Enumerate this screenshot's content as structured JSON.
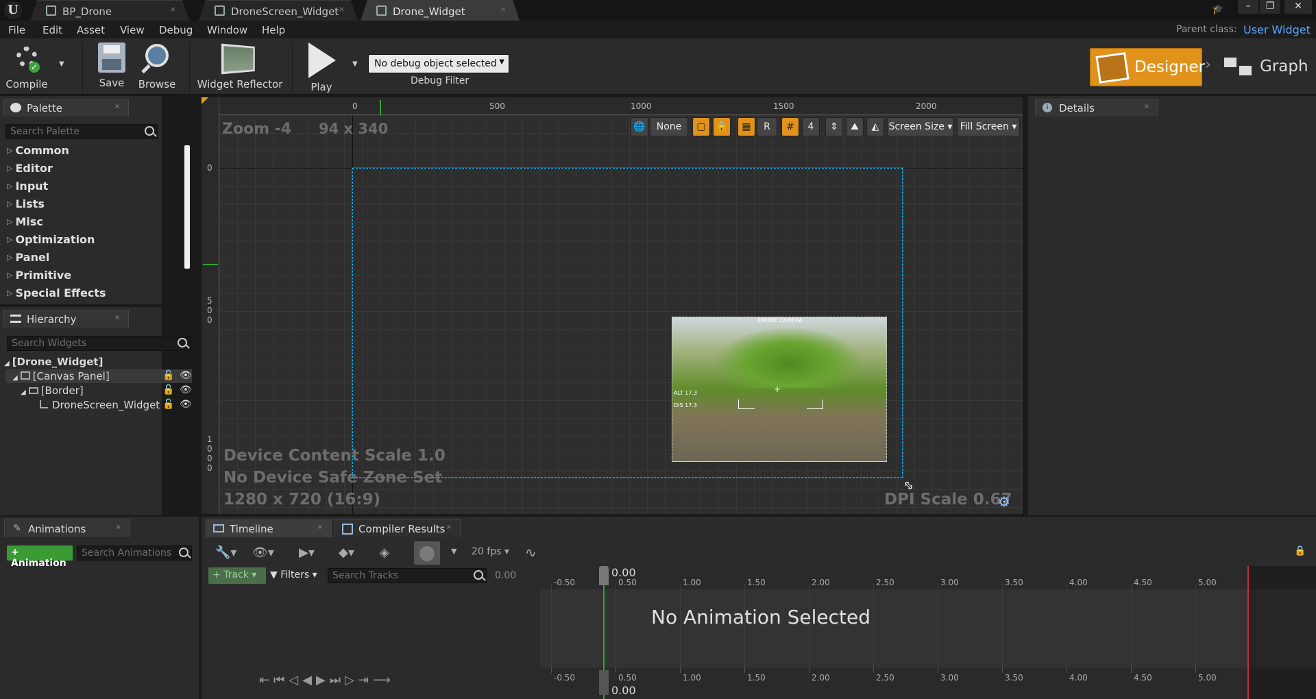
{
  "tabs": [
    {
      "label": "BP_Drone"
    },
    {
      "label": "DroneScreen_Widget"
    },
    {
      "label": "Drone_Widget"
    }
  ],
  "menu": [
    "File",
    "Edit",
    "Asset",
    "View",
    "Debug",
    "Window",
    "Help"
  ],
  "parent_class": {
    "label": "Parent class:",
    "value": "User Widget"
  },
  "toolbar": {
    "compile": "Compile",
    "save": "Save",
    "browse": "Browse",
    "reflector": "Widget Reflector",
    "play": "Play",
    "debug_select": "No debug object selected",
    "debug_filter": "Debug Filter"
  },
  "mode": {
    "designer": "Designer",
    "graph": "Graph"
  },
  "palette": {
    "title": "Palette",
    "search_placeholder": "Search Palette",
    "categories": [
      "Common",
      "Editor",
      "Input",
      "Lists",
      "Misc",
      "Optimization",
      "Panel",
      "Primitive",
      "Special Effects"
    ]
  },
  "hierarchy": {
    "title": "Hierarchy",
    "search_placeholder": "Search Widgets",
    "items": [
      "[Drone_Widget]",
      "[Canvas Panel]",
      "[Border]",
      "DroneScreen_Widget"
    ]
  },
  "details": {
    "title": "Details"
  },
  "viewport": {
    "zoom": "Zoom -4",
    "size": "94 x 340",
    "ruler_h": [
      "0",
      "500",
      "1000",
      "1500",
      "2000"
    ],
    "ruler_v0": "0",
    "ruler_v_500": [
      "5",
      "0",
      "0"
    ],
    "ruler_v_1000": [
      "1",
      "0",
      "0",
      "0"
    ],
    "none_label": "None",
    "r_label": "R",
    "grid_label": "4",
    "screen_size": "Screen Size",
    "fill_screen": "Fill Screen",
    "device_scale": "Device Content Scale 1.0",
    "safe_zone": "No Device Safe Zone Set",
    "resolution": "1280 x 720 (16:9)",
    "dpi": "DPI Scale 0.67"
  },
  "preview": {
    "title": "DRONE CAMERA",
    "alt": "ALT 17.3",
    "dis": "DIS 17.3"
  },
  "animations": {
    "title": "Animations",
    "add": "Animation",
    "search_placeholder": "Search Animations"
  },
  "timeline": {
    "tab1": "Timeline",
    "tab2": "Compiler Results",
    "fps": "20 fps",
    "track": "Track",
    "filters": "Filters",
    "search_placeholder": "Search Tracks",
    "value": "0.00",
    "current": "0.00",
    "current_bottom": "0.00",
    "empty": "No Animation Selected",
    "ticks": [
      "-0.50",
      "0.50",
      "1.00",
      "1.50",
      "2.00",
      "2.50",
      "3.00",
      "3.50",
      "4.00",
      "4.50",
      "5.00"
    ]
  },
  "colors": {
    "accent": "#e0921a",
    "selection": "#00b7ff",
    "tl_green": "#2fa52f",
    "tl_red": "#c0303c"
  }
}
